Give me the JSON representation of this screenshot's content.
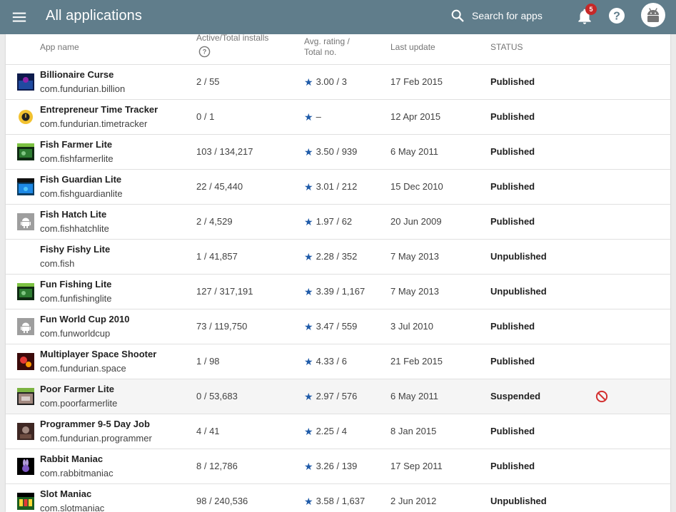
{
  "header": {
    "title": "All applications",
    "search_label": "Search for apps",
    "notification_count": "5"
  },
  "columns": {
    "app_name": "App name",
    "installs": "Active/Total installs",
    "rating_line1": "Avg. rating /",
    "rating_line2": "Total no.",
    "last_update": "Last update",
    "status": "STATUS"
  },
  "colors": {
    "topbar": "#607d8b",
    "star": "#1e5aa8",
    "suspended_icon": "#d32f2f",
    "notification_badge": "#c62828"
  },
  "apps": [
    {
      "name": "Billionaire Curse",
      "package": "com.fundurian.billion",
      "installs": "2 / 55",
      "rating": "3.00 / 3",
      "last_update": "17 Feb 2015",
      "status": "Published",
      "thumb": "game-thumbnail-dark-blue"
    },
    {
      "name": "Entrepreneur Time Tracker",
      "package": "com.fundurian.timetracker",
      "installs": "0 / 1",
      "rating": "–",
      "last_update": "12 Apr 2015",
      "status": "Published",
      "thumb": "clock-thumbnail-yellow"
    },
    {
      "name": "Fish Farmer Lite",
      "package": "com.fishfarmerlite",
      "installs": "103 / 134,217",
      "rating": "3.50 / 939",
      "last_update": "6 May 2011",
      "status": "Published",
      "thumb": "game-thumbnail-green"
    },
    {
      "name": "Fish Guardian Lite",
      "package": "com.fishguardianlite",
      "installs": "22 / 45,440",
      "rating": "3.01 / 212",
      "last_update": "15 Dec 2010",
      "status": "Published",
      "thumb": "game-thumbnail-ocean"
    },
    {
      "name": "Fish Hatch Lite",
      "package": "com.fishhatchlite",
      "installs": "2 / 4,529",
      "rating": "1.97 / 62",
      "last_update": "20 Jun 2009",
      "status": "Published",
      "thumb": "android-icon"
    },
    {
      "name": "Fishy Fishy Lite",
      "package": "com.fish",
      "installs": "1 / 41,857",
      "rating": "2.28 / 352",
      "last_update": "7 May 2013",
      "status": "Unpublished",
      "thumb": "none"
    },
    {
      "name": "Fun Fishing Lite",
      "package": "com.funfishinglite",
      "installs": "127 / 317,191",
      "rating": "3.39 / 1,167",
      "last_update": "7 May 2013",
      "status": "Unpublished",
      "thumb": "game-thumbnail-green"
    },
    {
      "name": "Fun World Cup 2010",
      "package": "com.funworldcup",
      "installs": "73 / 119,750",
      "rating": "3.47 / 559",
      "last_update": "3 Jul 2010",
      "status": "Published",
      "thumb": "android-icon"
    },
    {
      "name": "Multiplayer Space Shooter",
      "package": "com.fundurian.space",
      "installs": "1 / 98",
      "rating": "4.33 / 6",
      "last_update": "21 Feb 2015",
      "status": "Published",
      "thumb": "game-thumbnail-red"
    },
    {
      "name": "Poor Farmer Lite",
      "package": "com.poorfarmerlite",
      "installs": "0 / 53,683",
      "rating": "2.97 / 576",
      "last_update": "6 May 2011",
      "status": "Suspended",
      "thumb": "game-thumbnail-farm"
    },
    {
      "name": "Programmer 9-5 Day Job",
      "package": "com.fundurian.programmer",
      "installs": "4 / 41",
      "rating": "2.25 / 4",
      "last_update": "8 Jan 2015",
      "status": "Published",
      "thumb": "game-thumbnail-brown"
    },
    {
      "name": "Rabbit Maniac",
      "package": "com.rabbitmaniac",
      "installs": "8 / 12,786",
      "rating": "3.26 / 139",
      "last_update": "17 Sep 2011",
      "status": "Published",
      "thumb": "game-thumbnail-rabbit"
    },
    {
      "name": "Slot Maniac",
      "package": "com.slotmaniac",
      "installs": "98 / 240,536",
      "rating": "3.58 / 1,637",
      "last_update": "2 Jun 2012",
      "status": "Unpublished",
      "thumb": "game-thumbnail-slot"
    }
  ]
}
